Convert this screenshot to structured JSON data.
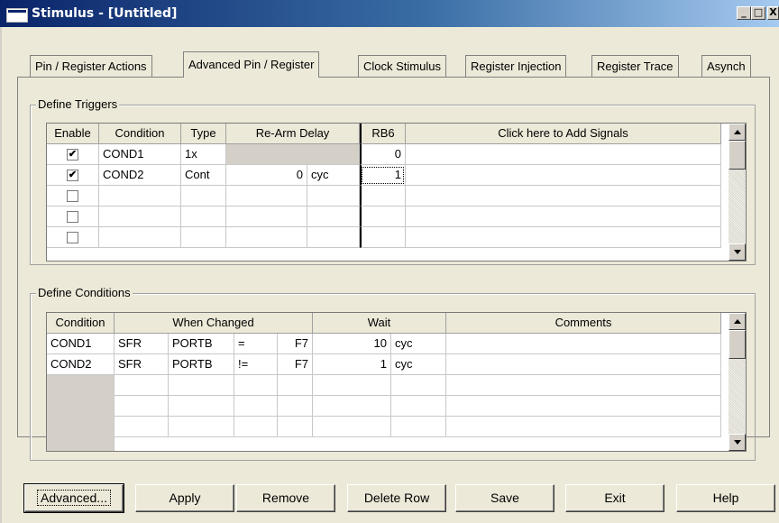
{
  "window": {
    "title": "Stimulus - [Untitled]"
  },
  "caption_buttons": {
    "minimize": "_",
    "maximize": "□",
    "close": "X"
  },
  "tabs": [
    {
      "label": "Pin / Register Actions",
      "active": false
    },
    {
      "label": "Advanced Pin / Register",
      "active": true
    },
    {
      "label": "Clock Stimulus",
      "active": false
    },
    {
      "label": "Register Injection",
      "active": false
    },
    {
      "label": "Register Trace",
      "active": false
    },
    {
      "label": "Asynch",
      "active": false
    }
  ],
  "triggers": {
    "group_label": "Define Triggers",
    "headers": {
      "enable": "Enable",
      "condition": "Condition",
      "type": "Type",
      "rearm": "Re-Arm Delay",
      "rb6": "RB6",
      "add": "Click here to Add Signals"
    },
    "rows": [
      {
        "enabled": true,
        "mark": "✔",
        "condition": "COND1",
        "type": "1x",
        "delay": "",
        "unit": "",
        "rb6": "0"
      },
      {
        "enabled": true,
        "mark": "✔",
        "condition": "COND2",
        "type": "Cont",
        "delay": "0",
        "unit": "cyc",
        "rb6": "1"
      },
      {
        "enabled": false,
        "mark": "",
        "condition": "",
        "type": "",
        "delay": "",
        "unit": "",
        "rb6": ""
      },
      {
        "enabled": false,
        "mark": "",
        "condition": "",
        "type": "",
        "delay": "",
        "unit": "",
        "rb6": ""
      }
    ]
  },
  "conditions": {
    "group_label": "Define Conditions",
    "headers": {
      "condition": "Condition",
      "when_changed": "When Changed",
      "wait": "Wait",
      "comments": "Comments"
    },
    "rows": [
      {
        "condition": "COND1",
        "sfr": "SFR",
        "reg": "PORTB",
        "op": "=",
        "val": "F7",
        "wait": "10",
        "unit": "cyc",
        "comment": ""
      },
      {
        "condition": "COND2",
        "sfr": "SFR",
        "reg": "PORTB",
        "op": "!=",
        "val": "F7",
        "wait": "1",
        "unit": "cyc",
        "comment": ""
      }
    ]
  },
  "buttons": {
    "advanced": "Advanced...",
    "apply": "Apply",
    "remove": "Remove",
    "delete_row": "Delete Row",
    "save": "Save",
    "exit": "Exit",
    "help": "Help"
  }
}
